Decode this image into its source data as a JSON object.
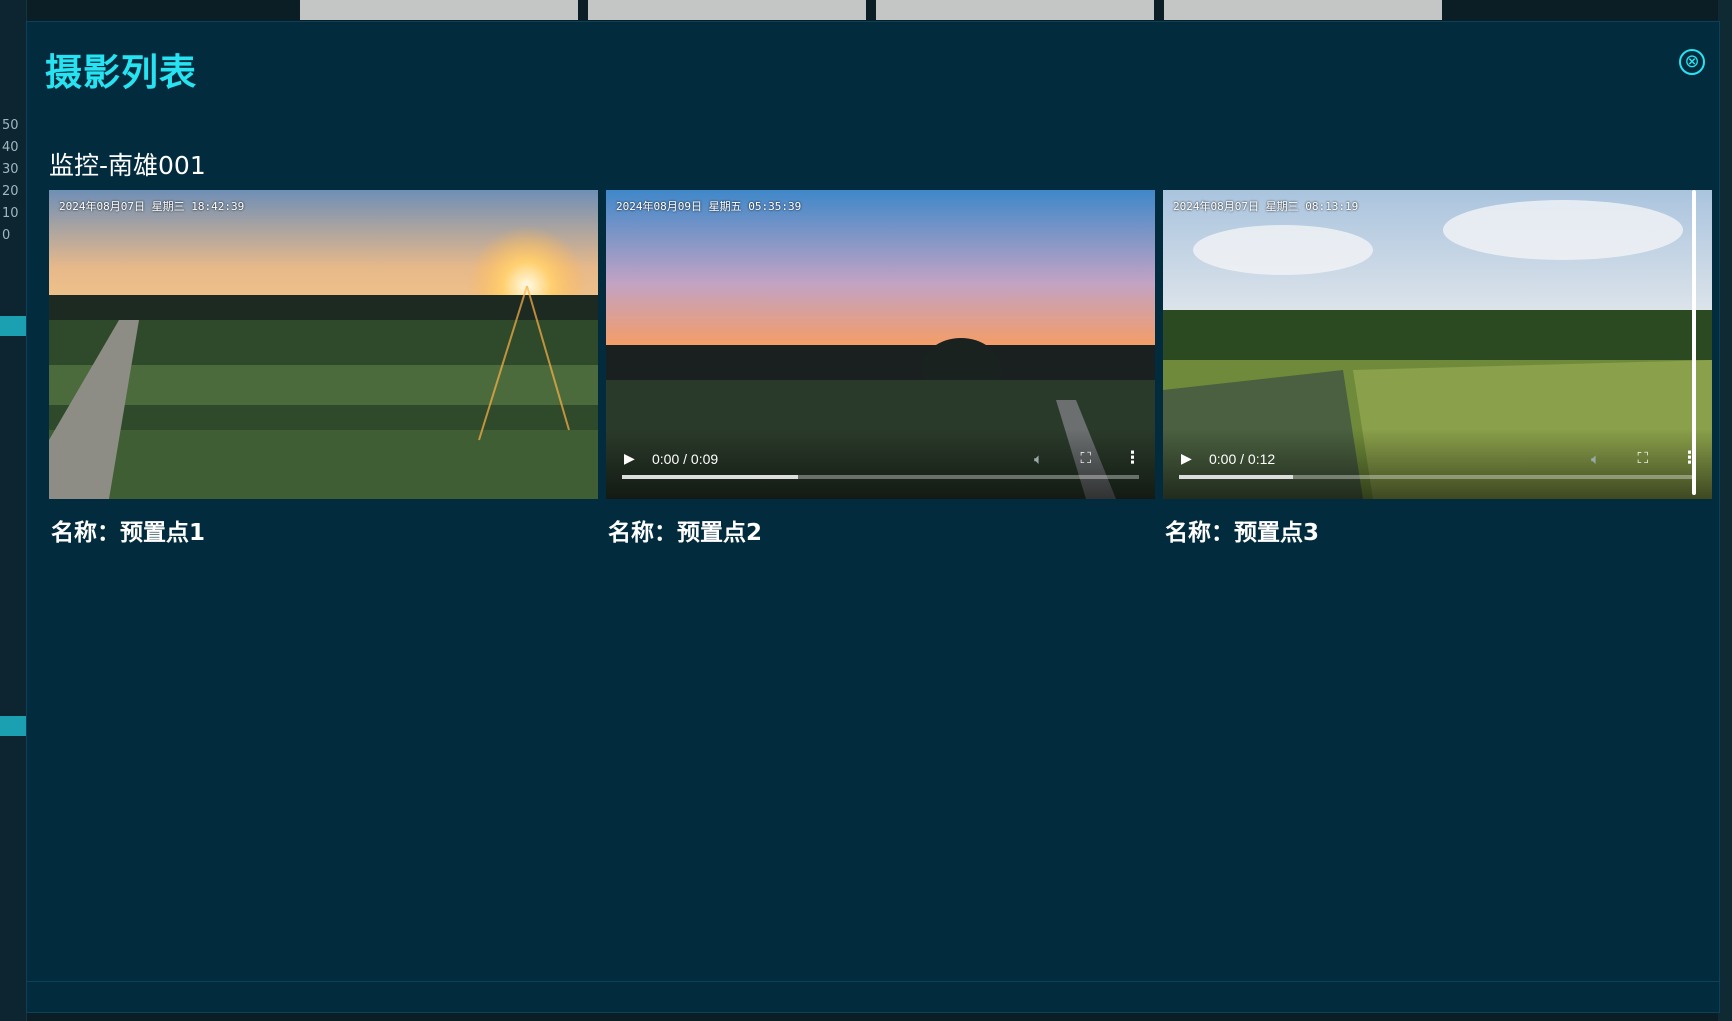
{
  "modal": {
    "title": "摄影列表",
    "close_label": "⊗",
    "section_title": "监控-南雄001"
  },
  "cards": [
    {
      "timestamp": "2024年08月07日 星期三 18:42:39",
      "name": "名称：预置点1",
      "has_controls": false
    },
    {
      "timestamp": "2024年08月09日 星期五 05:35:39",
      "name": "名称：预置点2",
      "time": "0:00 / 0:09",
      "progress": 0.34
    },
    {
      "timestamp": "2024年08月07日 星期三 08:13:19",
      "name": "名称：预置点3",
      "time": "0:00 / 0:12",
      "progress": 0.22
    }
  ],
  "background": {
    "left_ticks": [
      "50",
      "40",
      "30",
      "20",
      "10",
      "0"
    ]
  },
  "colors": {
    "accent": "#27e2f0",
    "modal_bg": "#022b3e"
  },
  "icons": {
    "play": "play-icon",
    "volume": "volume-icon",
    "fullscreen": "fullscreen-icon",
    "more": "more-vertical-icon",
    "close": "close-circle-icon"
  }
}
